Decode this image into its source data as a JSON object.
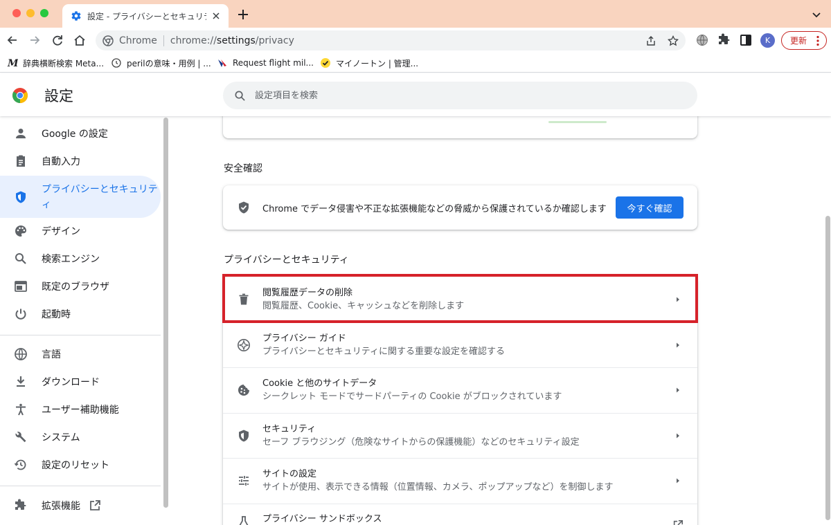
{
  "browser": {
    "tab_title": "設定 - プライバシーとセキュリティ",
    "omnibox_site": "Chrome",
    "omnibox_url_scheme": "chrome://",
    "omnibox_url_host": "settings",
    "omnibox_url_path": "/privacy",
    "avatar_initial": "K",
    "update_label": "更新",
    "bookmarks": [
      {
        "label": "辞典横断検索 Meta...",
        "icon": "m-logo-icon"
      },
      {
        "label": "perilの意味・用例 | ...",
        "icon": "refresh-site-icon"
      },
      {
        "label": "Request flight mil...",
        "icon": "airline-icon"
      },
      {
        "label": "マイノートン | 管理...",
        "icon": "norton-check-icon"
      }
    ]
  },
  "settings": {
    "title": "設定",
    "search_placeholder": "設定項目を検索"
  },
  "sidebar": {
    "items": [
      {
        "label": "Google の設定",
        "icon": "person-icon"
      },
      {
        "label": "自動入力",
        "icon": "clipboard-icon"
      },
      {
        "label": "プライバシーとセキュリティ",
        "icon": "shield-icon"
      },
      {
        "label": "デザイン",
        "icon": "palette-icon"
      },
      {
        "label": "検索エンジン",
        "icon": "search-icon"
      },
      {
        "label": "既定のブラウザ",
        "icon": "browser-window-icon"
      },
      {
        "label": "起動時",
        "icon": "power-icon"
      },
      {
        "label": "言語",
        "icon": "globe-icon"
      },
      {
        "label": "ダウンロード",
        "icon": "download-icon"
      },
      {
        "label": "ユーザー補助機能",
        "icon": "accessibility-icon"
      },
      {
        "label": "システム",
        "icon": "wrench-icon"
      },
      {
        "label": "設定のリセット",
        "icon": "history-icon"
      },
      {
        "label": "拡張機能",
        "icon": "puzzle-icon"
      }
    ]
  },
  "main": {
    "safety_check": {
      "heading": "安全確認",
      "text": "Chrome でデータ侵害や不正な拡張機能などの脅威から保護されているか確認します",
      "button": "今すぐ確認"
    },
    "privacy": {
      "heading": "プライバシーとセキュリティ",
      "rows": [
        {
          "title": "閲覧履歴データの削除",
          "desc": "閲覧履歴、Cookie、キャッシュなどを削除します",
          "icon": "trash-icon"
        },
        {
          "title": "プライバシー ガイド",
          "desc": "プライバシーとセキュリティに関する重要な設定を確認する",
          "icon": "compass-icon"
        },
        {
          "title": "Cookie と他のサイトデータ",
          "desc": "シークレット モードでサードパーティの Cookie がブロックされています",
          "icon": "cookie-icon"
        },
        {
          "title": "セキュリティ",
          "desc": "セーフ ブラウジング（危険なサイトからの保護機能）などのセキュリティ設定",
          "icon": "security-shield-icon"
        },
        {
          "title": "サイトの設定",
          "desc": "サイトが使用、表示できる情報（位置情報、カメラ、ポップアップなど）を制御します",
          "icon": "tune-icon"
        },
        {
          "title": "プライバシー サンドボックス",
          "desc": "",
          "icon": "flask-icon"
        }
      ]
    }
  },
  "colors": {
    "accent": "#1a73e8",
    "highlight_box": "#d6222a",
    "tab_bar": "#f9d4bf"
  }
}
